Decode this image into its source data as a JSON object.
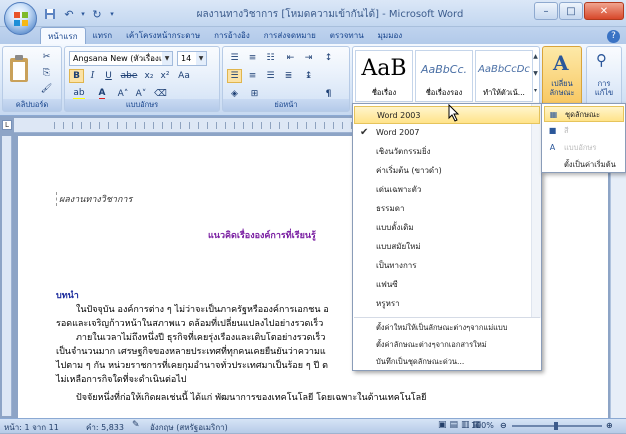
{
  "window": {
    "title": "ผลงานทางวิชาการ [โหมดความเข้ากันได้] - Microsoft Word",
    "controls": {
      "minimize": "–",
      "maximize": "□",
      "close": "✕"
    }
  },
  "tabs": [
    "หน้าแรก",
    "แทรก",
    "เค้าโครงหน้ากระดาษ",
    "การอ้างอิง",
    "การส่งจดหมาย",
    "ตรวจทาน",
    "มุมมอง"
  ],
  "ribbon": {
    "font_name": "Angsana New (หัวเรื่องแบบ",
    "font_size": "14",
    "groups": {
      "clipboard": "คลิปบอร์ด",
      "font": "แบบอักษร",
      "paragraph": "ย่อหน้า"
    },
    "quick_styles": [
      {
        "preview": "AaB",
        "name": "ชื่อเรื่อง"
      },
      {
        "preview": "AaBbCc.",
        "name": "ชื่อเรื่องรอง"
      },
      {
        "preview": "AaBbCcDc",
        "name": "ทำให้ตัวเน้..."
      }
    ],
    "change_styles_label": [
      "เปลี่ยน",
      "ลักษณะ"
    ],
    "editing_label": [
      "การ",
      "แก้ไข"
    ]
  },
  "document": {
    "header_text": "ผลงานทางวิชาการ",
    "title": "แนวคิดเรื่ององค์การที่เรียนรู้",
    "section_heading": "บทนำ",
    "paragraphs": [
      "ในปัจจุบัน องค์การต่าง ๆ ไม่ว่าจะเป็นภาครัฐหรือองค์การเอกชน อ",
      "รอดและเจริญก้าวหน้าในสภาพแว ดล้อมที่เปลี่ยนแปลงไปอย่างรวดเร็ว",
      "ภายในเวลาไม่ถึงหนึ่งปี ธุรกิจที่เคยรุ่งเรืองและเติบโตอย่างรวดเร็ว",
      "เป็นจำนวนมาก เศรษฐกิจของหลายประเทศที่ทุกคนเคยยืนยันว่าความแ",
      "ไปตาม ๆ กัน หน่วยราชการที่เคยกุมอำนาจทั่วประเทศมาเป็นร้อย ๆ ปี ต",
      "ไม่เหลือการกิจใดที่จะดำเนินต่อไป",
      "ปัจจัยหนึ่งที่ก่อให้เกิดผลเช่นนี้ ได้แก่ พัฒนาการของเทคโนโลยี โดยเฉพาะในด้านเทคโนโลยี"
    ]
  },
  "style_menu": {
    "items": [
      "Word 2003",
      "Word 2007",
      "เชิงนวัตกรรมยิ่ง",
      "ค่าเริ่มต้น (ขาวดำ)",
      "เด่นเฉพาะตัว",
      "ธรรมดา",
      "แบบดั้งเดิม",
      "แบบสมัยใหม่",
      "เป็นทางการ",
      "แฟนซี",
      "หรูหรา"
    ],
    "checked_item": "Word 2007",
    "highlighted_item": "Word 2003",
    "actions": [
      "ตั้งค่าใหม่ให้เป็นลักษณะต่างๆจากแม่แบบ",
      "ตั้งค่าลักษณะต่างๆจากเอกสารใหม่",
      "บันทึกเป็นชุดลักษณะด่วน..."
    ]
  },
  "submenu": {
    "items": [
      "ชุดลักษณะ",
      "สี",
      "แบบอักษร",
      "ตั้งเป็นค่าเริ่มต้น"
    ]
  },
  "statusbar": {
    "page": "หน้า: 1 จาก 11",
    "words": "คำ: 5,833",
    "language": "อังกฤษ (สหรัฐอเมริกา)",
    "zoom": "100%"
  }
}
